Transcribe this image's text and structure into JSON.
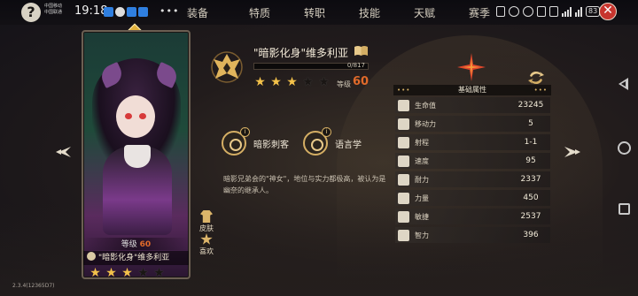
{
  "status_bar": {
    "carrier_lines": [
      "中国移动",
      "中国联通"
    ],
    "time": "19:18",
    "more": "•••",
    "battery": "83"
  },
  "help_label": "?",
  "close_label": "✕",
  "tabs": [
    "装备",
    "特质",
    "转职",
    "技能",
    "天赋",
    "赛季"
  ],
  "card": {
    "grade_label": "等级",
    "grade_value": "60",
    "name": "\"暗影化身\"维多利亚",
    "stars_filled": 3,
    "stars_total": 5
  },
  "side_buttons": {
    "skin": "皮肤",
    "like": "喜欢"
  },
  "hero": {
    "title": "\"暗影化身\"维多利亚",
    "xp_text": "0/817",
    "xp_progress": 0.0,
    "stars_filled": 3,
    "stars_total": 5,
    "level_label": "等级",
    "level_value": "60"
  },
  "traits": [
    {
      "label": "暗影刺客",
      "tag": "i"
    },
    {
      "label": "语言学",
      "tag": "i"
    }
  ],
  "description": "暗影兄弟会的\"神女\"，地位与实力都极高，被认为是幽奈的继承人。",
  "attributes": {
    "header": "基础属性",
    "header_dots": "•••",
    "rows": [
      {
        "name": "生命值",
        "value": "23245",
        "icon": "heart-icon"
      },
      {
        "name": "移动力",
        "value": "5",
        "icon": "boot-icon"
      },
      {
        "name": "射程",
        "value": "1-1",
        "icon": "target-icon"
      },
      {
        "name": "速度",
        "value": "95",
        "icon": "speed-icon"
      },
      {
        "name": "耐力",
        "value": "2337",
        "icon": "shield-icon"
      },
      {
        "name": "力量",
        "value": "450",
        "icon": "fist-icon"
      },
      {
        "name": "敏捷",
        "value": "2537",
        "icon": "agility-icon"
      },
      {
        "name": "智力",
        "value": "396",
        "icon": "star-icon"
      }
    ]
  },
  "version": "2.3.4(12365D7)",
  "colors": {
    "accent_gold": "#d4ae64",
    "level_orange": "#e06a2a",
    "star_gold": "#f4c24a",
    "close_red": "#c7352e"
  }
}
